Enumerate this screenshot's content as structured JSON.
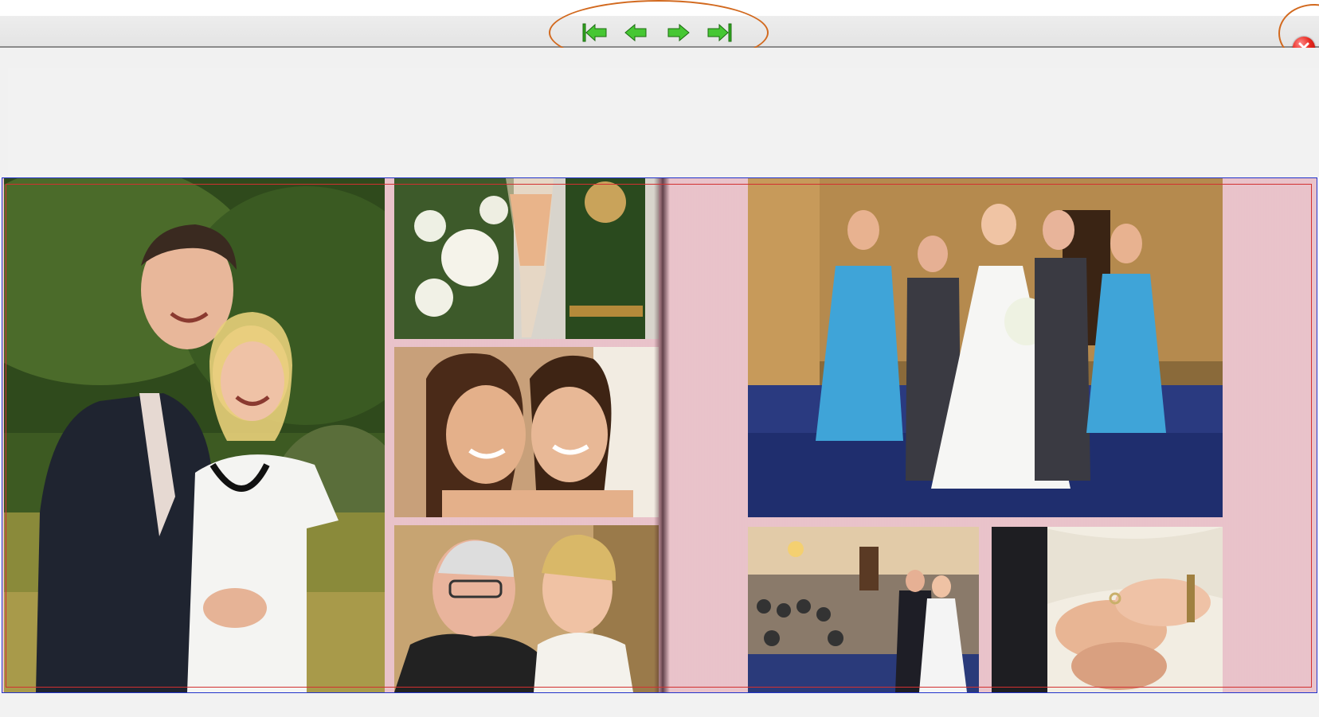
{
  "toolbar": {
    "buttons": [
      {
        "name": "first-page-button",
        "icon": "first-page-icon"
      },
      {
        "name": "previous-page-button",
        "icon": "arrow-left-icon"
      },
      {
        "name": "next-page-button",
        "icon": "arrow-right-icon"
      },
      {
        "name": "last-page-button",
        "icon": "last-page-icon"
      }
    ],
    "close_icon": "close-icon"
  },
  "colors": {
    "nav_arrow": "#33bb22",
    "annotation_ellipse": "#d2691e",
    "close_red": "#e8281e",
    "page_pink": "#e9c2c9",
    "spread_border": "#2233cc",
    "crop_border": "#d23030"
  },
  "album": {
    "left_page_photos": [
      "couple-portrait-photo",
      "flowers-champagne-photo",
      "bridesmaids-closeup-photo",
      "father-and-bride-photo"
    ],
    "right_page_photos": [
      "wedding-party-group-photo",
      "ceremony-room-photo",
      "ring-exchange-photo"
    ]
  }
}
